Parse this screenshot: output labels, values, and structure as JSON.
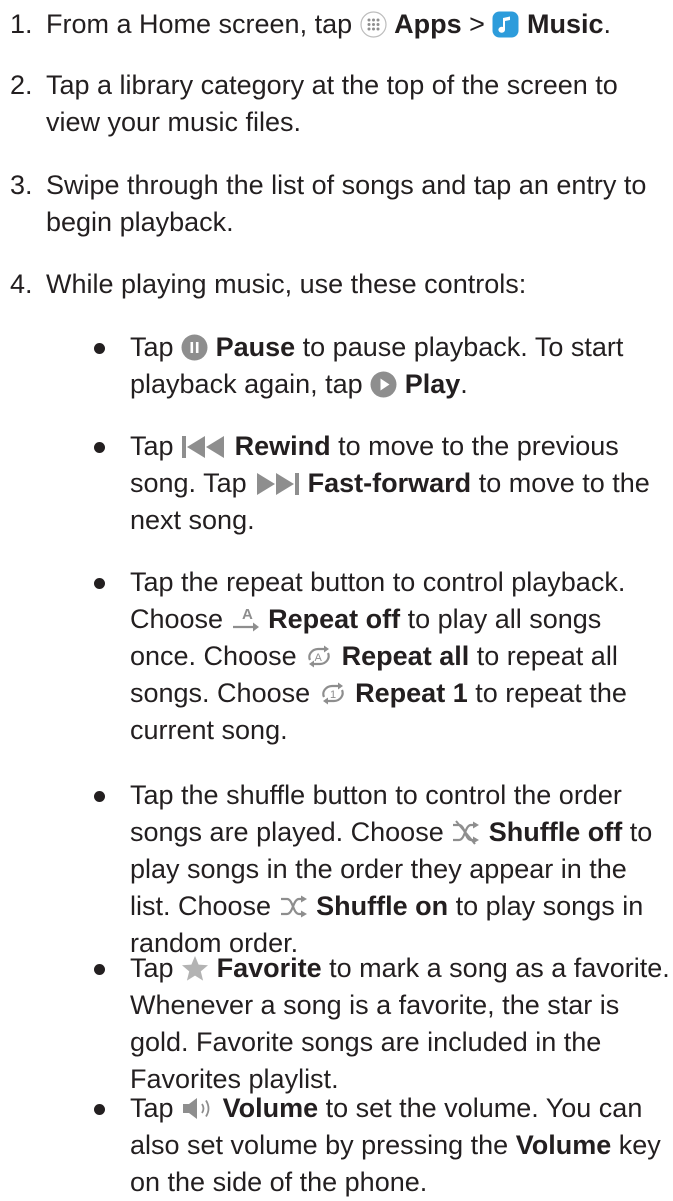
{
  "steps": [
    {
      "num": "1.",
      "pre": "From a Home screen, tap",
      "apps": "Apps",
      "sep": ">",
      "music": "Music",
      "end": "."
    },
    {
      "num": "2.",
      "text": "Tap a library category at the top of the screen to view your music files."
    },
    {
      "num": "3.",
      "text": "Swipe through the list of songs and tap an entry to begin playback."
    },
    {
      "num": "4.",
      "text": "While playing music, use these controls:"
    }
  ],
  "bullets": {
    "pause": {
      "t1": "Tap",
      "b1": "Pause",
      "t2": "to pause playback. To start playback again, tap",
      "b2": "Play",
      "t3": "."
    },
    "rewind": {
      "t1": "Tap",
      "b1": "Rewind",
      "t2": "to move to the previous song. Tap",
      "b2": "Fast-forward",
      "t3": "to move to the next song."
    },
    "repeat": {
      "t1": "Tap the repeat button to control playback. Choose",
      "b1": "Repeat off",
      "t2": "to play all songs once. Choose",
      "b2": "Repeat all",
      "t3": "to repeat all songs. Choose",
      "b3": "Repeat 1",
      "t4": "to repeat the current song."
    },
    "shuffle": {
      "t1": "Tap the shuffle button to control the order songs are played. Choose",
      "b1": "Shuffle off",
      "t2": "to play songs in the order they appear in the list. Choose",
      "b2": "Shuffle on",
      "t3": "to play songs in random order."
    },
    "favorite": {
      "t1": "Tap",
      "b1": "Favorite",
      "t2": "to mark a song as a favorite. Whenever a song is a favorite, the star is gold. Favorite songs are included in the Favorites playlist."
    },
    "volume": {
      "t1": "Tap",
      "b1": "Volume",
      "t2": "to set the volume. You can also set volume by pressing the",
      "b2": "Volume",
      "t3": "key on the side of the phone."
    }
  },
  "icons": {
    "apps": "apps-grid-icon",
    "music": "music-note-icon",
    "pause": "pause-icon",
    "play": "play-icon",
    "rewind": "rewind-icon",
    "fast_forward": "fast-forward-icon",
    "repeat_off": "repeat-off-icon",
    "repeat_all": "repeat-all-icon",
    "repeat_one": "repeat-one-icon",
    "shuffle_off": "shuffle-off-icon",
    "shuffle_on": "shuffle-on-icon",
    "favorite": "star-icon",
    "volume": "volume-icon"
  },
  "icon_text": {
    "repeat_letter": "A",
    "repeat_all_letter": "A",
    "repeat_one_digit": "1"
  },
  "colors": {
    "text": "#231f20",
    "icon_gray": "#8e8e8e",
    "music_blue": "#2d9cdb",
    "star": "#b3b3b3"
  }
}
